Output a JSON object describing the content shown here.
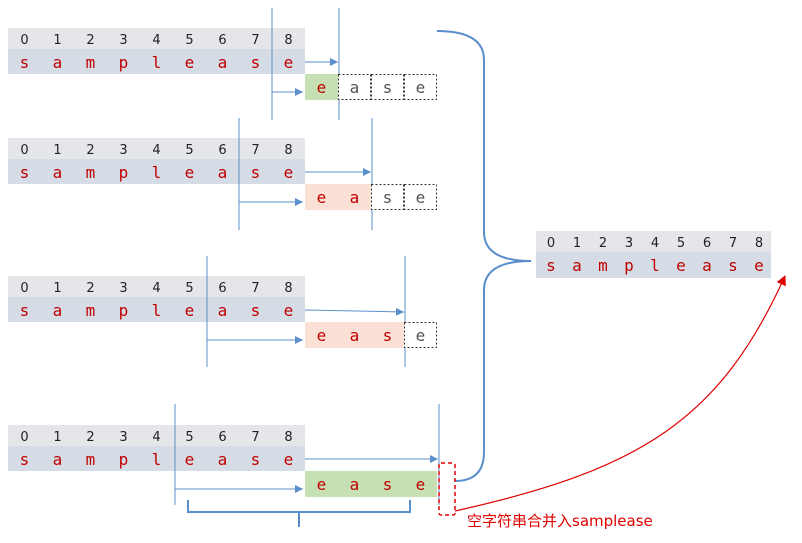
{
  "colors": {
    "index_row": "#e4e6ea",
    "char_row": "#d6dce5",
    "match_green": "#c6e0b4",
    "match_pink": "#fbe0d5",
    "blue": "#5b8fcb",
    "red_text": "#c00000",
    "annotation_red": "#e00000"
  },
  "rows": [
    {
      "indices": [
        "0",
        "1",
        "2",
        "3",
        "4",
        "5",
        "6",
        "7",
        "8"
      ],
      "chars": [
        "s",
        "a",
        "m",
        "p",
        "l",
        "e",
        "a",
        "s",
        "e"
      ],
      "highlight_chars": [
        "e"
      ],
      "dotted_chars": [
        "a",
        "s",
        "e"
      ]
    },
    {
      "indices": [
        "0",
        "1",
        "2",
        "3",
        "4",
        "5",
        "6",
        "7",
        "8"
      ],
      "chars": [
        "s",
        "a",
        "m",
        "p",
        "l",
        "e",
        "a",
        "s",
        "e"
      ],
      "highlight_chars": [
        "e",
        "a"
      ],
      "dotted_chars": [
        "s",
        "e"
      ]
    },
    {
      "indices": [
        "0",
        "1",
        "2",
        "3",
        "4",
        "5",
        "6",
        "7",
        "8"
      ],
      "chars": [
        "s",
        "a",
        "m",
        "p",
        "l",
        "e",
        "a",
        "s",
        "e"
      ],
      "highlight_chars": [
        "e",
        "a",
        "s"
      ],
      "dotted_chars": [
        "e"
      ]
    },
    {
      "indices": [
        "0",
        "1",
        "2",
        "3",
        "4",
        "5",
        "6",
        "7",
        "8"
      ],
      "chars": [
        "s",
        "a",
        "m",
        "p",
        "l",
        "e",
        "a",
        "s",
        "e"
      ],
      "highlight_chars": [
        "e",
        "a",
        "s",
        "e"
      ],
      "dotted_chars": []
    }
  ],
  "result": {
    "indices": [
      "0",
      "1",
      "2",
      "3",
      "4",
      "5",
      "6",
      "7",
      "8"
    ],
    "chars": [
      "s",
      "a",
      "m",
      "p",
      "l",
      "e",
      "a",
      "s",
      "e"
    ]
  },
  "annotation": "空字符串合并入samplease"
}
